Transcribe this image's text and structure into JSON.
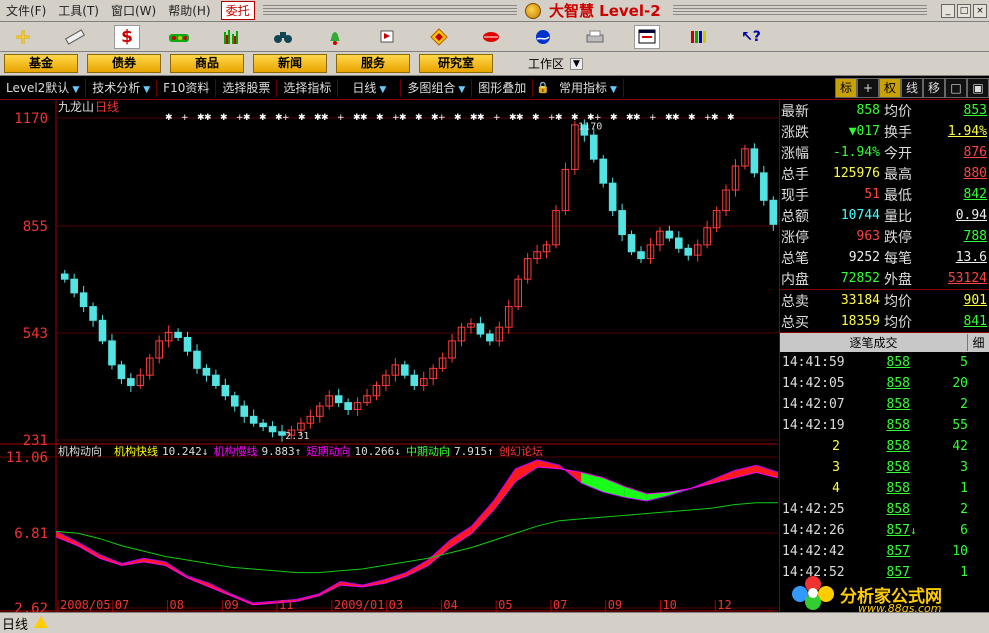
{
  "menubar": {
    "items": [
      "文件(F)",
      "工具(T)",
      "窗口(W)",
      "帮助(H)"
    ],
    "trade_label": "委托",
    "brand": "大智慧 Level-2"
  },
  "iconbar": {
    "icons": [
      "crosshair-icon",
      "ruler-icon",
      "dollar-icon",
      "tank-icon",
      "bars-icon",
      "binoculars-icon",
      "bell-icon",
      "flag-icon",
      "diamond-icon",
      "lips-icon",
      "globe-icon",
      "printer-icon",
      "window-icon",
      "books-icon",
      "help-cursor-icon"
    ]
  },
  "categories": {
    "buttons": [
      "基金",
      "债券",
      "商品",
      "新闻",
      "服务",
      "研究室"
    ],
    "workspace": "工作区"
  },
  "funcbar": {
    "items": [
      "Level2默认",
      "技术分析",
      "F10资料",
      "选择股票",
      "选择指标",
      "日线",
      "多图组合",
      "图形叠加",
      "常用指标"
    ],
    "right_tabs": [
      "标",
      "+",
      "权",
      "线",
      "移",
      "□",
      "▣"
    ]
  },
  "chart_data": [
    {
      "type": "candlestick",
      "title": "九龙山",
      "period": "日线",
      "y_labels": [
        "1170",
        "855",
        "543",
        "231"
      ],
      "ylim": [
        231,
        1170
      ],
      "high_label": "1170",
      "low_label": "2.31",
      "close_series": [
        700,
        660,
        620,
        580,
        520,
        450,
        410,
        390,
        420,
        470,
        520,
        545,
        530,
        490,
        440,
        420,
        390,
        360,
        330,
        300,
        280,
        270,
        255,
        245,
        260,
        280,
        300,
        330,
        360,
        340,
        320,
        340,
        360,
        390,
        420,
        450,
        420,
        390,
        410,
        440,
        470,
        520,
        560,
        570,
        540,
        520,
        560,
        620,
        700,
        760,
        780,
        800,
        900,
        1020,
        1150,
        1120,
        1050,
        980,
        900,
        830,
        780,
        760,
        800,
        840,
        820,
        790,
        770,
        800,
        850,
        900,
        960,
        1030,
        1080,
        1010,
        930,
        860
      ]
    },
    {
      "type": "indicator",
      "legend": [
        {
          "name": "机构动向",
          "value": ""
        },
        {
          "name": "机构快线",
          "value": "10.242↓"
        },
        {
          "name": "机构慢线",
          "value": "9.883↑"
        },
        {
          "name": "短期动向",
          "value": "10.266↓"
        },
        {
          "name": "中期动向",
          "value": "7.915↑"
        },
        {
          "name": "创幻论坛",
          "value": ""
        }
      ],
      "y_labels": [
        "11.06",
        "6.81",
        "2.62"
      ],
      "ylim": [
        2.62,
        11.06
      ],
      "x_labels": [
        "2008/05",
        "07",
        "08",
        "09",
        "11",
        "2009/01",
        "03",
        "04",
        "05",
        "07",
        "09",
        "10",
        "12"
      ],
      "fast": [
        6.9,
        6.3,
        5.6,
        5.1,
        5.4,
        5.2,
        4.4,
        4.0,
        3.4,
        2.9,
        3.0,
        3.1,
        3.4,
        4.1,
        3.9,
        4.2,
        4.6,
        5.3,
        6.4,
        7.2,
        8.6,
        10.4,
        10.9,
        10.6,
        9.6,
        9.1,
        8.8,
        8.6,
        8.9,
        9.3,
        9.8,
        10.3,
        10.6,
        10.2
      ],
      "slow": [
        6.6,
        6.1,
        5.4,
        5.0,
        5.2,
        5.0,
        4.3,
        3.8,
        3.3,
        2.8,
        2.9,
        3.0,
        3.3,
        3.9,
        3.8,
        4.0,
        4.4,
        5.0,
        6.0,
        6.8,
        8.1,
        9.7,
        10.5,
        10.4,
        10.2,
        9.9,
        9.4,
        9.0,
        9.1,
        9.3,
        9.6,
        9.9,
        10.2,
        9.9
      ],
      "mid": [
        6.9,
        6.8,
        6.5,
        6.1,
        5.8,
        5.5,
        5.3,
        5.1,
        4.9,
        4.8,
        4.7,
        4.6,
        4.6,
        4.7,
        4.8,
        5.0,
        5.2,
        5.4,
        5.7,
        6.0,
        6.4,
        6.8,
        7.2,
        7.5,
        7.6,
        7.7,
        7.8,
        7.9,
        8.0,
        8.1,
        8.2,
        8.4,
        8.5,
        8.5
      ]
    }
  ],
  "quote": {
    "rows": [
      {
        "l1": "最新",
        "v1": "858",
        "c1": "green",
        "l2": "均价",
        "v2": "853",
        "c2": "green"
      },
      {
        "l1": "涨跌",
        "v1": "▼017",
        "c1": "green",
        "l2": "换手",
        "v2": "1.94%",
        "c2": "yellow"
      },
      {
        "l1": "涨幅",
        "v1": "-1.94%",
        "c1": "green",
        "l2": "今开",
        "v2": "876",
        "c2": "red"
      },
      {
        "l1": "总手",
        "v1": "125976",
        "c1": "yellow",
        "l2": "最高",
        "v2": "880",
        "c2": "red"
      },
      {
        "l1": "现手",
        "v1": "51",
        "c1": "red",
        "l2": "最低",
        "v2": "842",
        "c2": "green"
      },
      {
        "l1": "总额",
        "v1": "10744",
        "c1": "cyan",
        "l2": "量比",
        "v2": "0.94",
        "c2": "white"
      },
      {
        "l1": "涨停",
        "v1": "963",
        "c1": "red",
        "l2": "跌停",
        "v2": "788",
        "c2": "green"
      },
      {
        "l1": "总笔",
        "v1": "9252",
        "c1": "white",
        "l2": "每笔",
        "v2": "13.6",
        "c2": "white"
      },
      {
        "l1": "内盘",
        "v1": "72852",
        "c1": "green",
        "l2": "外盘",
        "v2": "53124",
        "c2": "red"
      }
    ],
    "rows2": [
      {
        "l1": "总卖",
        "v1": "33184",
        "c1": "yellow",
        "l2": "均价",
        "v2": "901",
        "c2": "yellow"
      },
      {
        "l1": "总买",
        "v1": "18359",
        "c1": "yellow",
        "l2": "均价",
        "v2": "841",
        "c2": "green"
      }
    ],
    "ticks_title": "逐笔成交",
    "ticks_detail": "细",
    "ticks": [
      {
        "time": "14:41:59",
        "price": "858",
        "arrow": "",
        "vol": "5"
      },
      {
        "time": "14:42:05",
        "price": "858",
        "arrow": "",
        "vol": "20"
      },
      {
        "time": "14:42:07",
        "price": "858",
        "arrow": "",
        "vol": "2"
      },
      {
        "time": "14:42:19",
        "price": "858",
        "arrow": "",
        "vol": "55"
      },
      {
        "time": "2",
        "price": "858",
        "arrow": "",
        "vol": "42"
      },
      {
        "time": "3",
        "price": "858",
        "arrow": "",
        "vol": "3"
      },
      {
        "time": "4",
        "price": "858",
        "arrow": "",
        "vol": "1"
      },
      {
        "time": "14:42:25",
        "price": "858",
        "arrow": "",
        "vol": "2"
      },
      {
        "time": "14:42:26",
        "price": "857",
        "arrow": "↓",
        "vol": "6"
      },
      {
        "time": "14:42:42",
        "price": "857",
        "arrow": "",
        "vol": "10"
      },
      {
        "time": "14:42:52",
        "price": "857",
        "arrow": "",
        "vol": "1"
      }
    ]
  },
  "statusbar": {
    "label": "日线"
  },
  "watermark": {
    "text": "分析家公式网",
    "url": "www.88gs.com"
  }
}
